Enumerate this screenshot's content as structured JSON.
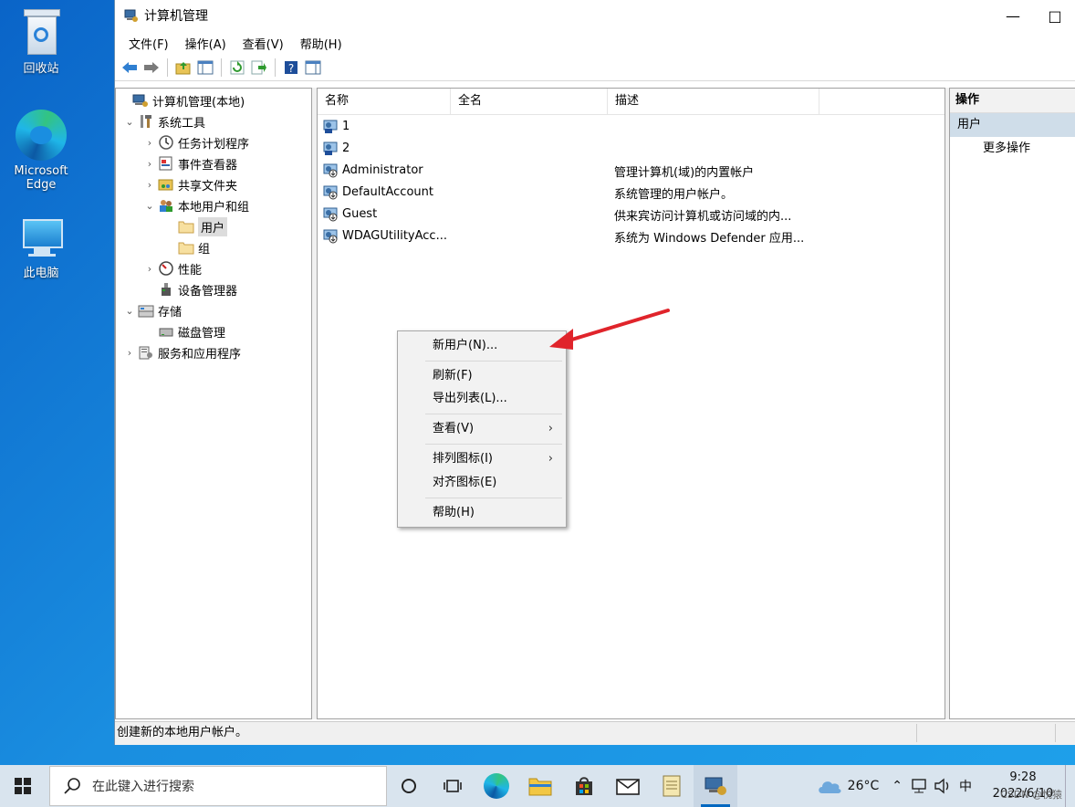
{
  "desktop": {
    "icons": [
      {
        "label": "回收站"
      },
      {
        "label": "Microsoft Edge"
      },
      {
        "label": "此电脑"
      }
    ]
  },
  "window": {
    "title": "计算机管理",
    "controls": {
      "minimize": "—",
      "maximize": "□"
    },
    "menu": [
      "文件(F)",
      "操作(A)",
      "查看(V)",
      "帮助(H)"
    ]
  },
  "tree": {
    "items": [
      {
        "label": "计算机管理(本地)"
      },
      {
        "label": "系统工具"
      },
      {
        "label": "任务计划程序"
      },
      {
        "label": "事件查看器"
      },
      {
        "label": "共享文件夹"
      },
      {
        "label": "本地用户和组"
      },
      {
        "label": "用户"
      },
      {
        "label": "组"
      },
      {
        "label": "性能"
      },
      {
        "label": "设备管理器"
      },
      {
        "label": "存储"
      },
      {
        "label": "磁盘管理"
      },
      {
        "label": "服务和应用程序"
      }
    ]
  },
  "list": {
    "columns": [
      "名称",
      "全名",
      "描述"
    ],
    "rows": [
      {
        "name": "1",
        "full_name": "",
        "description": ""
      },
      {
        "name": "2",
        "full_name": "",
        "description": ""
      },
      {
        "name": "Administrator",
        "full_name": "",
        "description": "管理计算机(域)的内置帐户"
      },
      {
        "name": "DefaultAccount",
        "full_name": "",
        "description": "系统管理的用户帐户。"
      },
      {
        "name": "Guest",
        "full_name": "",
        "description": "供来宾访问计算机或访问域的内..."
      },
      {
        "name": "WDAGUtilityAcc...",
        "full_name": "",
        "description": "系统为 Windows Defender 应用..."
      }
    ]
  },
  "actions": {
    "header": "操作",
    "section": "用户",
    "more": "更多操作"
  },
  "context_menu": {
    "items": [
      {
        "label": "新用户(N)..."
      },
      {
        "label": "刷新(F)"
      },
      {
        "label": "导出列表(L)..."
      },
      {
        "label": "查看(V)",
        "submenu": "›"
      },
      {
        "label": "排列图标(I)",
        "submenu": "›"
      },
      {
        "label": "对齐图标(E)"
      },
      {
        "label": "帮助(H)"
      }
    ]
  },
  "status": {
    "text": "创建新的本地用户帐户。"
  },
  "taskbar": {
    "search_placeholder": "在此键入进行搜索",
    "weather": "26°C",
    "ime": "中",
    "time": "9:28",
    "date": "2022/6/10"
  },
  "watermark": "CSDN @悦猿",
  "colors": {
    "accent": "#0067c0",
    "arrow": "#e0242b",
    "desktop": "#1a8ee0"
  }
}
